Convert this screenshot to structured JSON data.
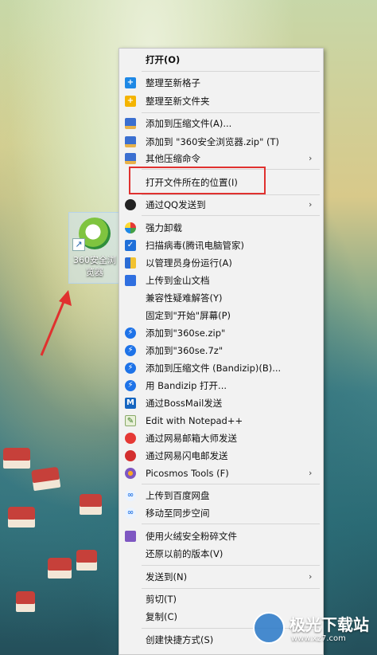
{
  "desktop": {
    "icon_label": "360安全浏览器"
  },
  "menu": {
    "open": "打开(O)",
    "organize_new_grid": "整理至新格子",
    "organize_new_folder": "整理至新文件夹",
    "add_to_archive": "添加到压缩文件(A)...",
    "add_to_zip": "添加到 \"360安全浏览器.zip\" (T)",
    "other_compress": "其他压缩命令",
    "open_file_location": "打开文件所在的位置(I)",
    "send_via_qq": "通过QQ发送到",
    "force_uninstall": "强力卸载",
    "scan_virus": "扫描病毒(腾讯电脑管家)",
    "run_as_admin": "以管理员身份运行(A)",
    "upload_kingsoft": "上传到金山文档",
    "compat_troubleshoot": "兼容性疑难解答(Y)",
    "pin_start": "固定到\"开始\"屏幕(P)",
    "add_360se_zip": "添加到\"360se.zip\"",
    "add_360se_7z": "添加到\"360se.7z\"",
    "add_bandizip": "添加到压缩文件 (Bandizip)(B)...",
    "open_bandizip": "用 Bandizip 打开...",
    "send_bossmail": "通过BossMail发送",
    "edit_notepad": "Edit with Notepad++",
    "send_netease_master": "通过网易邮箱大师发送",
    "send_netease_flash": "通过网易闪电邮发送",
    "picosmos": "Picosmos Tools (F)",
    "upload_baidu": "上传到百度网盘",
    "move_sync": "移动至同步空间",
    "huorong_shred": "使用火绒安全粉碎文件",
    "restore_previous": "还原以前的版本(V)",
    "send_to": "发送到(N)",
    "cut": "剪切(T)",
    "copy": "复制(C)",
    "create_shortcut": "创建快捷方式(S)",
    "submenu_arrow": "›"
  },
  "watermark": {
    "title": "极光下载站",
    "url": "www.xz7.com"
  },
  "colors": {
    "highlight_border": "#e0312f",
    "menu_bg": "#f2f2f2"
  }
}
